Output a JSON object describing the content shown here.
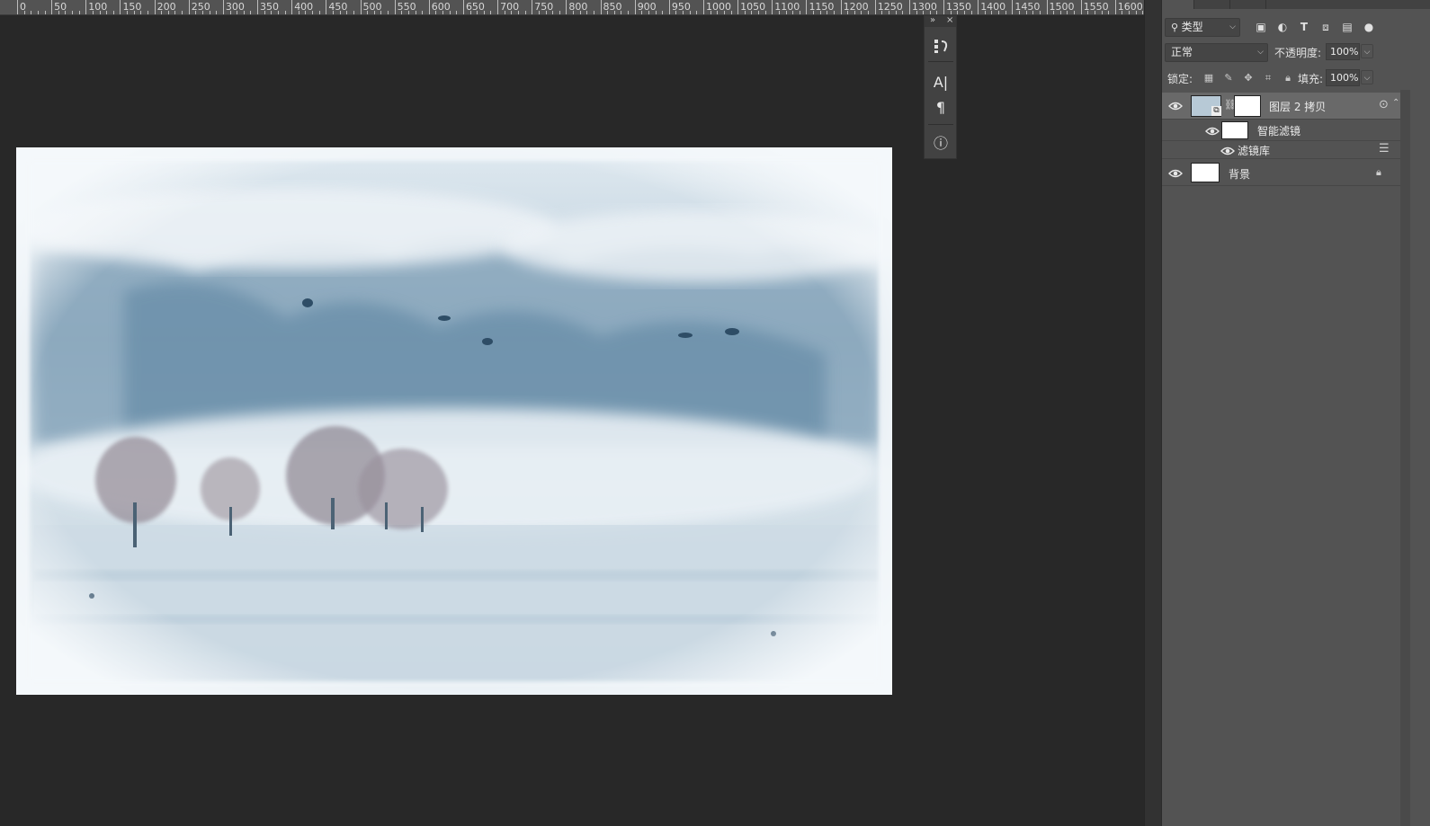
{
  "ruler": {
    "labels": [
      "0",
      "50",
      "100",
      "150",
      "200",
      "250",
      "300",
      "350",
      "400",
      "450",
      "500",
      "550",
      "600",
      "650",
      "700",
      "750",
      "800",
      "850",
      "900",
      "950",
      "1000",
      "1050",
      "1100",
      "1150",
      "1200",
      "1250",
      "1300",
      "1350",
      "1400",
      "1450",
      "1500",
      "1550",
      "1600"
    ]
  },
  "mini_panel": {
    "buttons": [
      "history-brush-icon",
      "character-icon",
      "paragraph-icon",
      "info-icon"
    ],
    "character_glyph": "A|",
    "paragraph_glyph": "¶",
    "info_glyph": "ⓘ"
  },
  "layers_panel": {
    "filter_kind_label": "类型",
    "blend_mode": "正常",
    "opacity_label": "不透明度:",
    "opacity_value": "100%",
    "lock_label": "锁定:",
    "fill_label": "填充:",
    "fill_value": "100%",
    "layers": [
      {
        "name": "图层 2 拷贝",
        "type": "smart-object"
      },
      {
        "name": "智能滤镜",
        "type": "smart-filter"
      },
      {
        "name": "滤镜库",
        "type": "filter"
      },
      {
        "name": "背景",
        "type": "background",
        "locked": true
      }
    ]
  },
  "colors": {
    "canvas_bg": "#282828",
    "panel_bg": "#535353",
    "ruler_bg": "#535353",
    "selected_layer": "#696969"
  }
}
